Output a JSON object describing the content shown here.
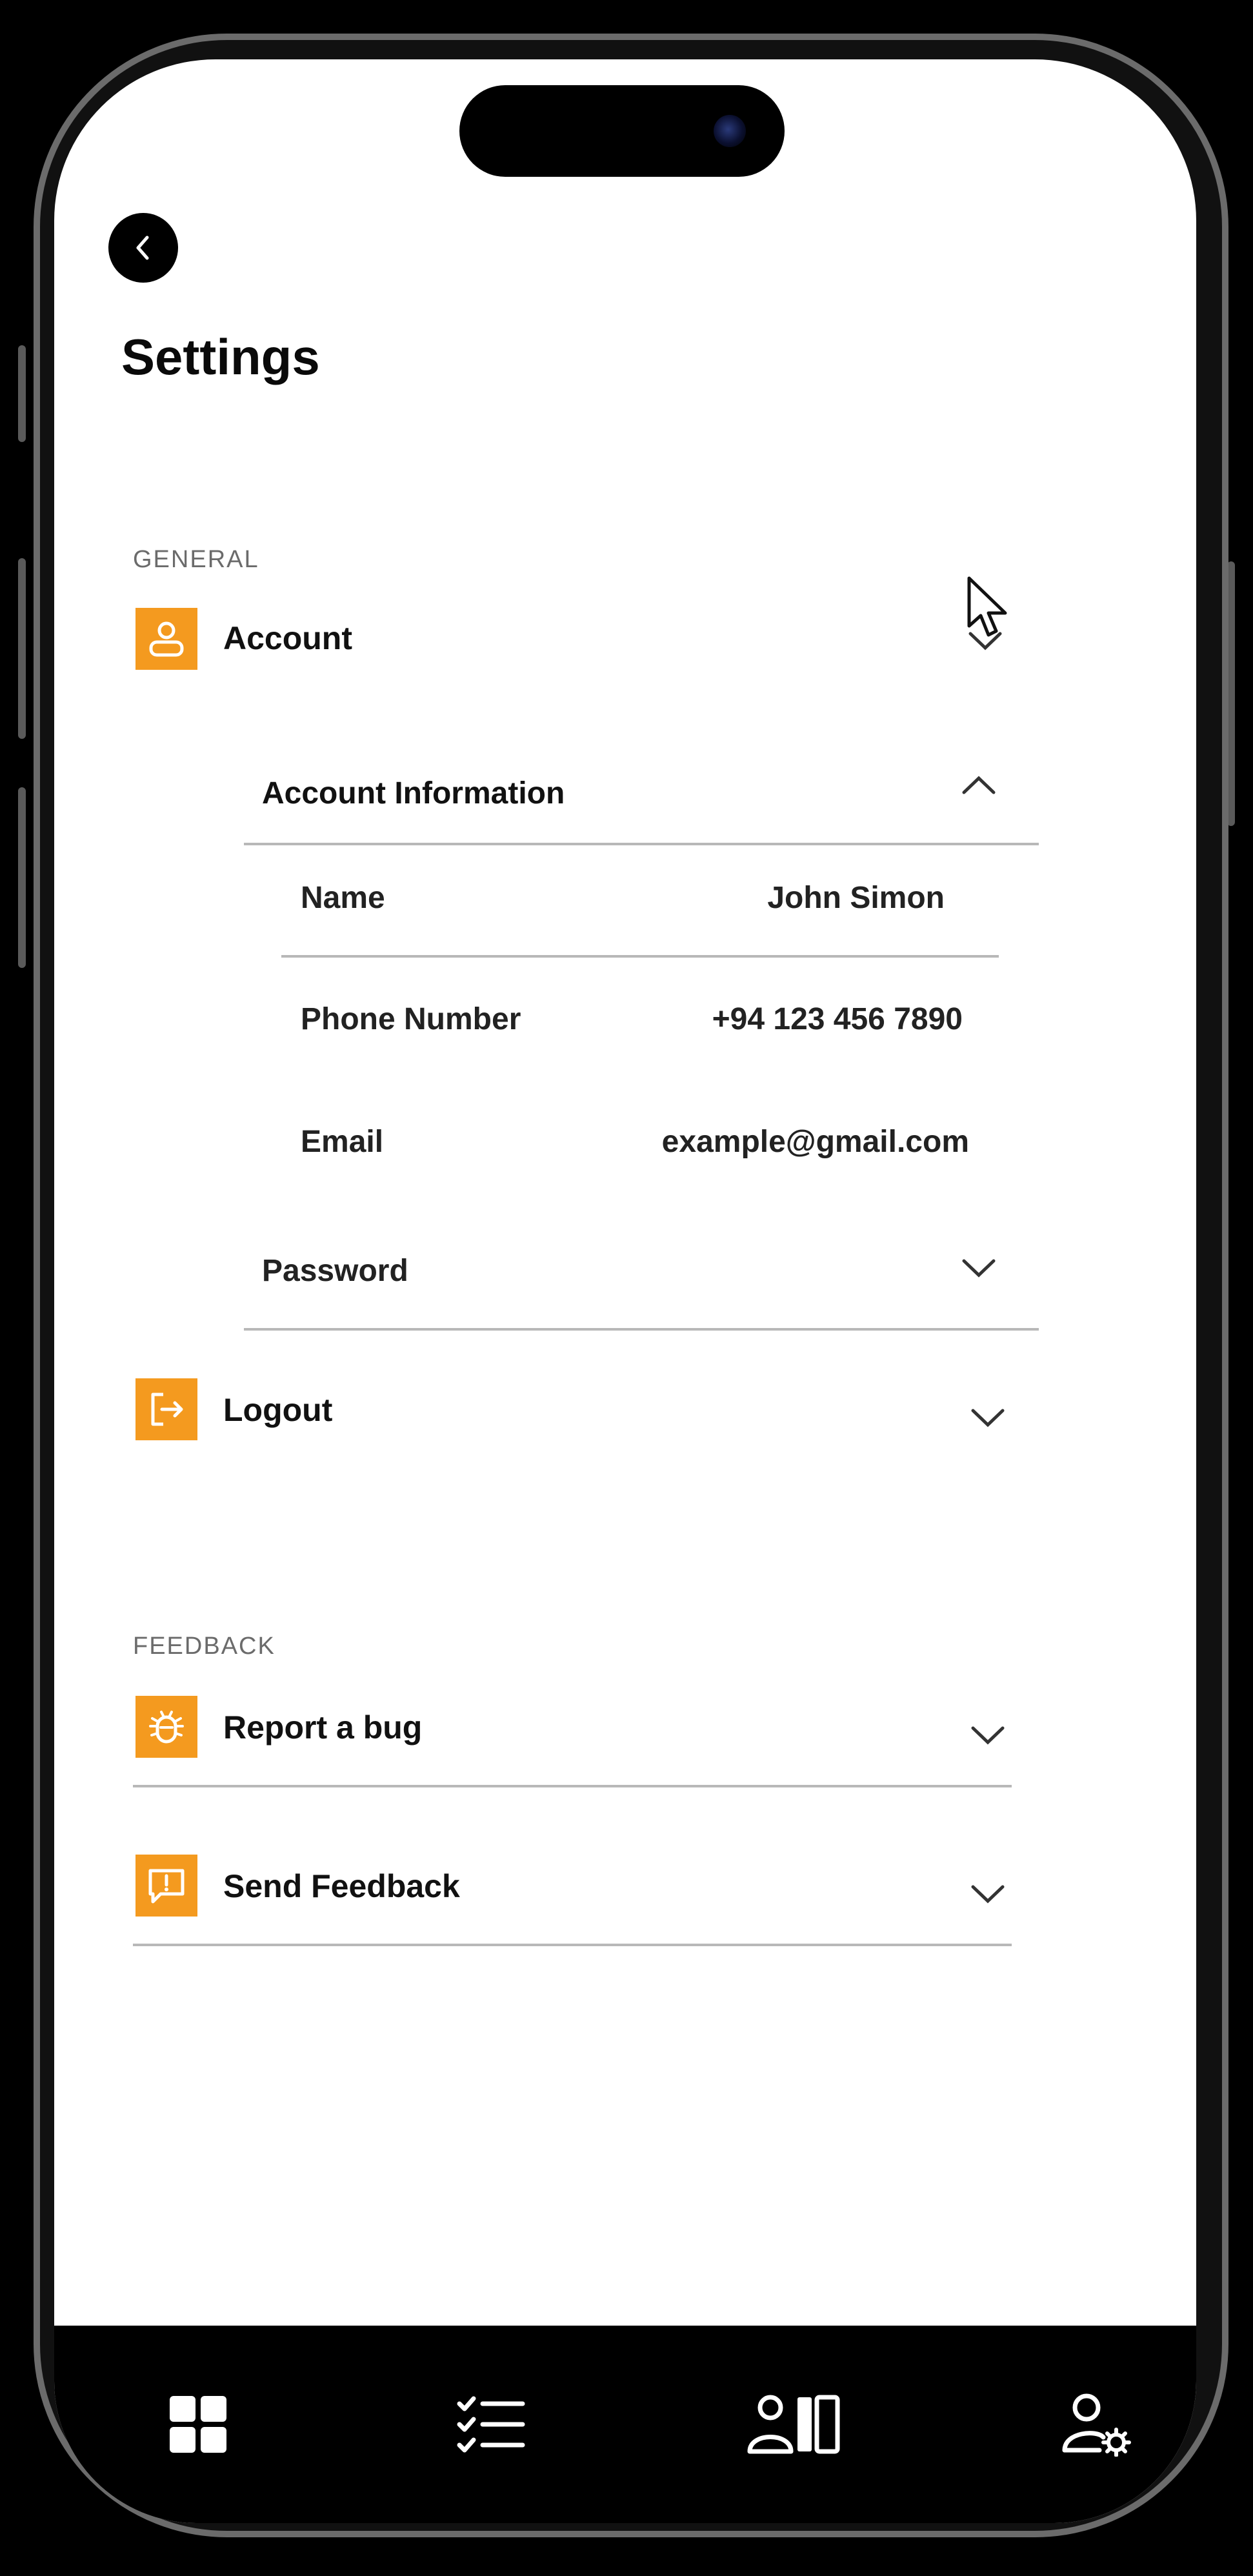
{
  "header": {
    "title": "Settings"
  },
  "general": {
    "section_label": "GENERAL",
    "account": {
      "label": "Account",
      "info": {
        "title": "Account Information",
        "fields": [
          {
            "label": "Name",
            "value": "John Simon"
          },
          {
            "label": "Phone Number",
            "value": "+94 123 456 7890"
          },
          {
            "label": "Email",
            "value": "example@gmail.com"
          }
        ]
      },
      "password_label": "Password"
    },
    "logout_label": "Logout"
  },
  "feedback": {
    "section_label": "FEEDBACK",
    "report_bug_label": "Report a bug",
    "send_feedback_label": "Send Feedback"
  },
  "tabbar": {
    "items": [
      {
        "icon": "grid-icon"
      },
      {
        "icon": "checklist-icon"
      },
      {
        "icon": "user-board-icon"
      },
      {
        "icon": "user-settings-icon"
      }
    ]
  },
  "colors": {
    "accent": "#f49a1f",
    "background": "#ffffff",
    "tabbar": "#000000"
  }
}
